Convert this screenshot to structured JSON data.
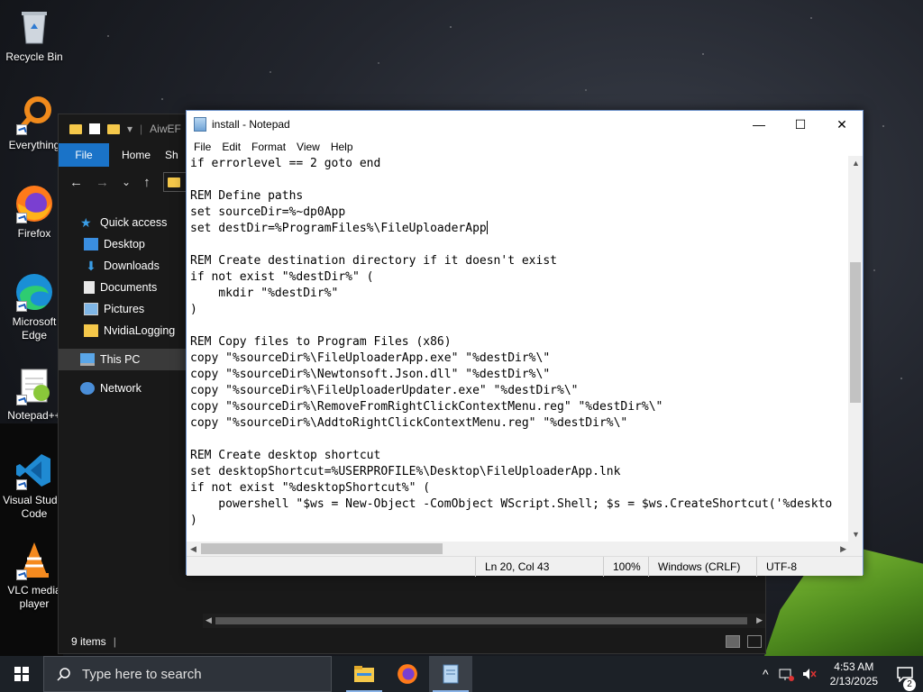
{
  "desktop": {
    "icons": [
      {
        "label": "Recycle Bin"
      },
      {
        "label": "Everything"
      },
      {
        "label": "Firefox"
      },
      {
        "label": "Microsoft Edge"
      },
      {
        "label": "Notepad++"
      },
      {
        "label": "Visual Studio Code"
      },
      {
        "label": "VLC media player"
      }
    ]
  },
  "explorer": {
    "title": "AiwEF",
    "ribbon": {
      "file": "File",
      "home": "Home",
      "share": "Sh"
    },
    "nav": {
      "back": "←",
      "forward": "→",
      "dropdown": "⌄",
      "up": "↑"
    },
    "tree": [
      {
        "label": "Quick access"
      },
      {
        "label": "Desktop"
      },
      {
        "label": "Downloads"
      },
      {
        "label": "Documents"
      },
      {
        "label": "Pictures"
      },
      {
        "label": "NvidiaLogging"
      },
      {
        "label": "This PC"
      },
      {
        "label": "Network"
      }
    ],
    "status": "9 items"
  },
  "notepad": {
    "title": "install - Notepad",
    "window_buttons": {
      "minimize": "—",
      "maximize": "☐",
      "close": "✕"
    },
    "menu": [
      "File",
      "Edit",
      "Format",
      "View",
      "Help"
    ],
    "lines": [
      "if errorlevel == 2 goto end",
      "",
      "REM Define paths",
      "set sourceDir=%~dp0App",
      "set destDir=%ProgramFiles%\\FileUploaderApp",
      "",
      "REM Create destination directory if it doesn't exist",
      "if not exist \"%destDir%\" (",
      "    mkdir \"%destDir%\"",
      ")",
      "",
      "REM Copy files to Program Files (x86)",
      "copy \"%sourceDir%\\FileUploaderApp.exe\" \"%destDir%\\\"",
      "copy \"%sourceDir%\\Newtonsoft.Json.dll\" \"%destDir%\\\"",
      "copy \"%sourceDir%\\FileUploaderUpdater.exe\" \"%destDir%\\\"",
      "copy \"%sourceDir%\\RemoveFromRightClickContextMenu.reg\" \"%destDir%\\\"",
      "copy \"%sourceDir%\\AddtoRightClickContextMenu.reg\" \"%destDir%\\\"",
      "",
      "REM Create desktop shortcut",
      "set desktopShortcut=%USERPROFILE%\\Desktop\\FileUploaderApp.lnk",
      "if not exist \"%desktopShortcut%\" (",
      "    powershell \"$ws = New-Object -ComObject WScript.Shell; $s = $ws.CreateShortcut('%deskto",
      ")"
    ],
    "caret_line": 4,
    "status": {
      "position": "Ln 20, Col 43",
      "zoom": "100%",
      "line_ending": "Windows (CRLF)",
      "encoding": "UTF-8"
    }
  },
  "taskbar": {
    "search_placeholder": "Type here to search",
    "time": "4:53 AM",
    "date": "2/13/2025",
    "notification_count": "2",
    "tray_chevron": "^"
  }
}
